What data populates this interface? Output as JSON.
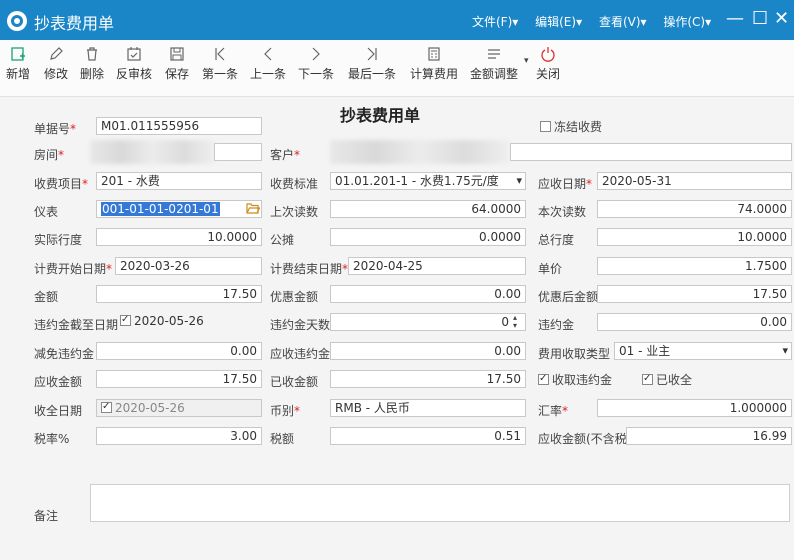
{
  "window": {
    "title": "抄表费用单",
    "menus": [
      "文件(F)▾",
      "编辑(E)▾",
      "查看(V)▾",
      "操作(C)▾"
    ],
    "minimize": "—",
    "maximize": "☐",
    "close": "✕"
  },
  "toolbar": {
    "new": "新增",
    "edit": "修改",
    "delete": "删除",
    "unaudit": "反审核",
    "save": "保存",
    "first": "第一条",
    "prev": "上一条",
    "next": "下一条",
    "last": "最后一条",
    "calc_fee": "计算费用",
    "adjust_amount": "金额调整",
    "close": "关闭"
  },
  "form": {
    "heading": "抄表费用单",
    "bill_no": {
      "label": "单据号",
      "value": "M01.011555956"
    },
    "freeze": {
      "label": "冻结收费",
      "checked": false
    },
    "room": {
      "label": "房间"
    },
    "customer": {
      "label": "客户"
    },
    "fee_item": {
      "label": "收费项目",
      "value": "201 - 水费"
    },
    "fee_standard": {
      "label": "收费标准",
      "value": "01.01.201-1 - 水费1.75元/度"
    },
    "due_date": {
      "label": "应收日期",
      "value": "2020-05-31"
    },
    "meter": {
      "label": "仪表",
      "value": "001-01-01-0201-01"
    },
    "last_reading": {
      "label": "上次读数",
      "value": "64.0000"
    },
    "this_reading": {
      "label": "本次读数",
      "value": "74.0000"
    },
    "actual_usage": {
      "label": "实际行度",
      "value": "10.0000"
    },
    "shared": {
      "label": "公摊",
      "value": "0.0000"
    },
    "total_usage": {
      "label": "总行度",
      "value": "10.0000"
    },
    "start_date": {
      "label": "计费开始日期",
      "value": "2020-03-26"
    },
    "end_date": {
      "label": "计费结束日期",
      "value": "2020-04-25"
    },
    "unit_price": {
      "label": "单价",
      "value": "1.7500"
    },
    "amount": {
      "label": "金额",
      "value": "17.50"
    },
    "discount": {
      "label": "优惠金额",
      "value": "0.00"
    },
    "after_discount": {
      "label": "优惠后金额",
      "value": "17.50"
    },
    "penalty_cutoff": {
      "label": "违约金截至日期",
      "value": "2020-05-26",
      "checked": true
    },
    "penalty_days": {
      "label": "违约金天数",
      "value": "0"
    },
    "penalty": {
      "label": "违约金",
      "value": "0.00"
    },
    "penalty_waived": {
      "label": "减免违约金",
      "value": "0.00"
    },
    "penalty_due": {
      "label": "应收违约金",
      "value": "0.00"
    },
    "fee_type": {
      "label": "费用收取类型",
      "value": "01 - 业主"
    },
    "amount_due": {
      "label": "应收金额",
      "value": "17.50"
    },
    "amount_received": {
      "label": "已收金额",
      "value": "17.50"
    },
    "collect_penalty": {
      "label": "收取违约金",
      "checked": true
    },
    "fully_received": {
      "label": "已收全",
      "checked": true
    },
    "full_date": {
      "label": "收全日期",
      "value": "2020-05-26",
      "checked": true
    },
    "currency": {
      "label": "币别",
      "value": "RMB - 人民币"
    },
    "exchange_rate": {
      "label": "汇率",
      "value": "1.000000"
    },
    "tax_rate": {
      "label": "税率%",
      "value": "3.00"
    },
    "tax": {
      "label": "税额",
      "value": "0.51"
    },
    "amount_ex_tax": {
      "label": "应收金额(不含税)",
      "value": "16.99"
    },
    "remark": {
      "label": "备注",
      "value": ""
    }
  },
  "colors": {
    "titlebar": "#1a86c8",
    "required": "#e02020",
    "selection": "#3478d8"
  }
}
